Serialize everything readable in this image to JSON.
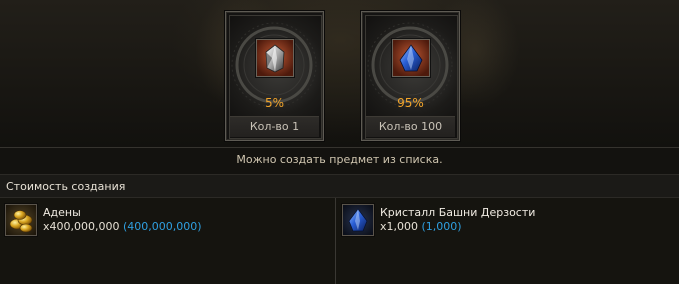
{
  "craft_results": [
    {
      "chance": "5%",
      "quantity": "Кол-во 1",
      "icon": "silver-crystal-icon"
    },
    {
      "chance": "95%",
      "quantity": "Кол-во 100",
      "icon": "blue-crystal-icon"
    }
  ],
  "notice": "Можно создать предмет из списка.",
  "cost_title": "Стоимость создания",
  "costs": [
    {
      "name": "Адены",
      "amount": "x400,000,000",
      "owned": "(400,000,000)",
      "icon": "adena-coins-icon"
    },
    {
      "name": "Кристалл Башни Дерзости",
      "amount": "x1,000",
      "owned": "(1,000)",
      "icon": "blue-crystal-icon"
    }
  ],
  "colors": {
    "chance": "#f2a52b",
    "owned": "#2f9fe0"
  }
}
